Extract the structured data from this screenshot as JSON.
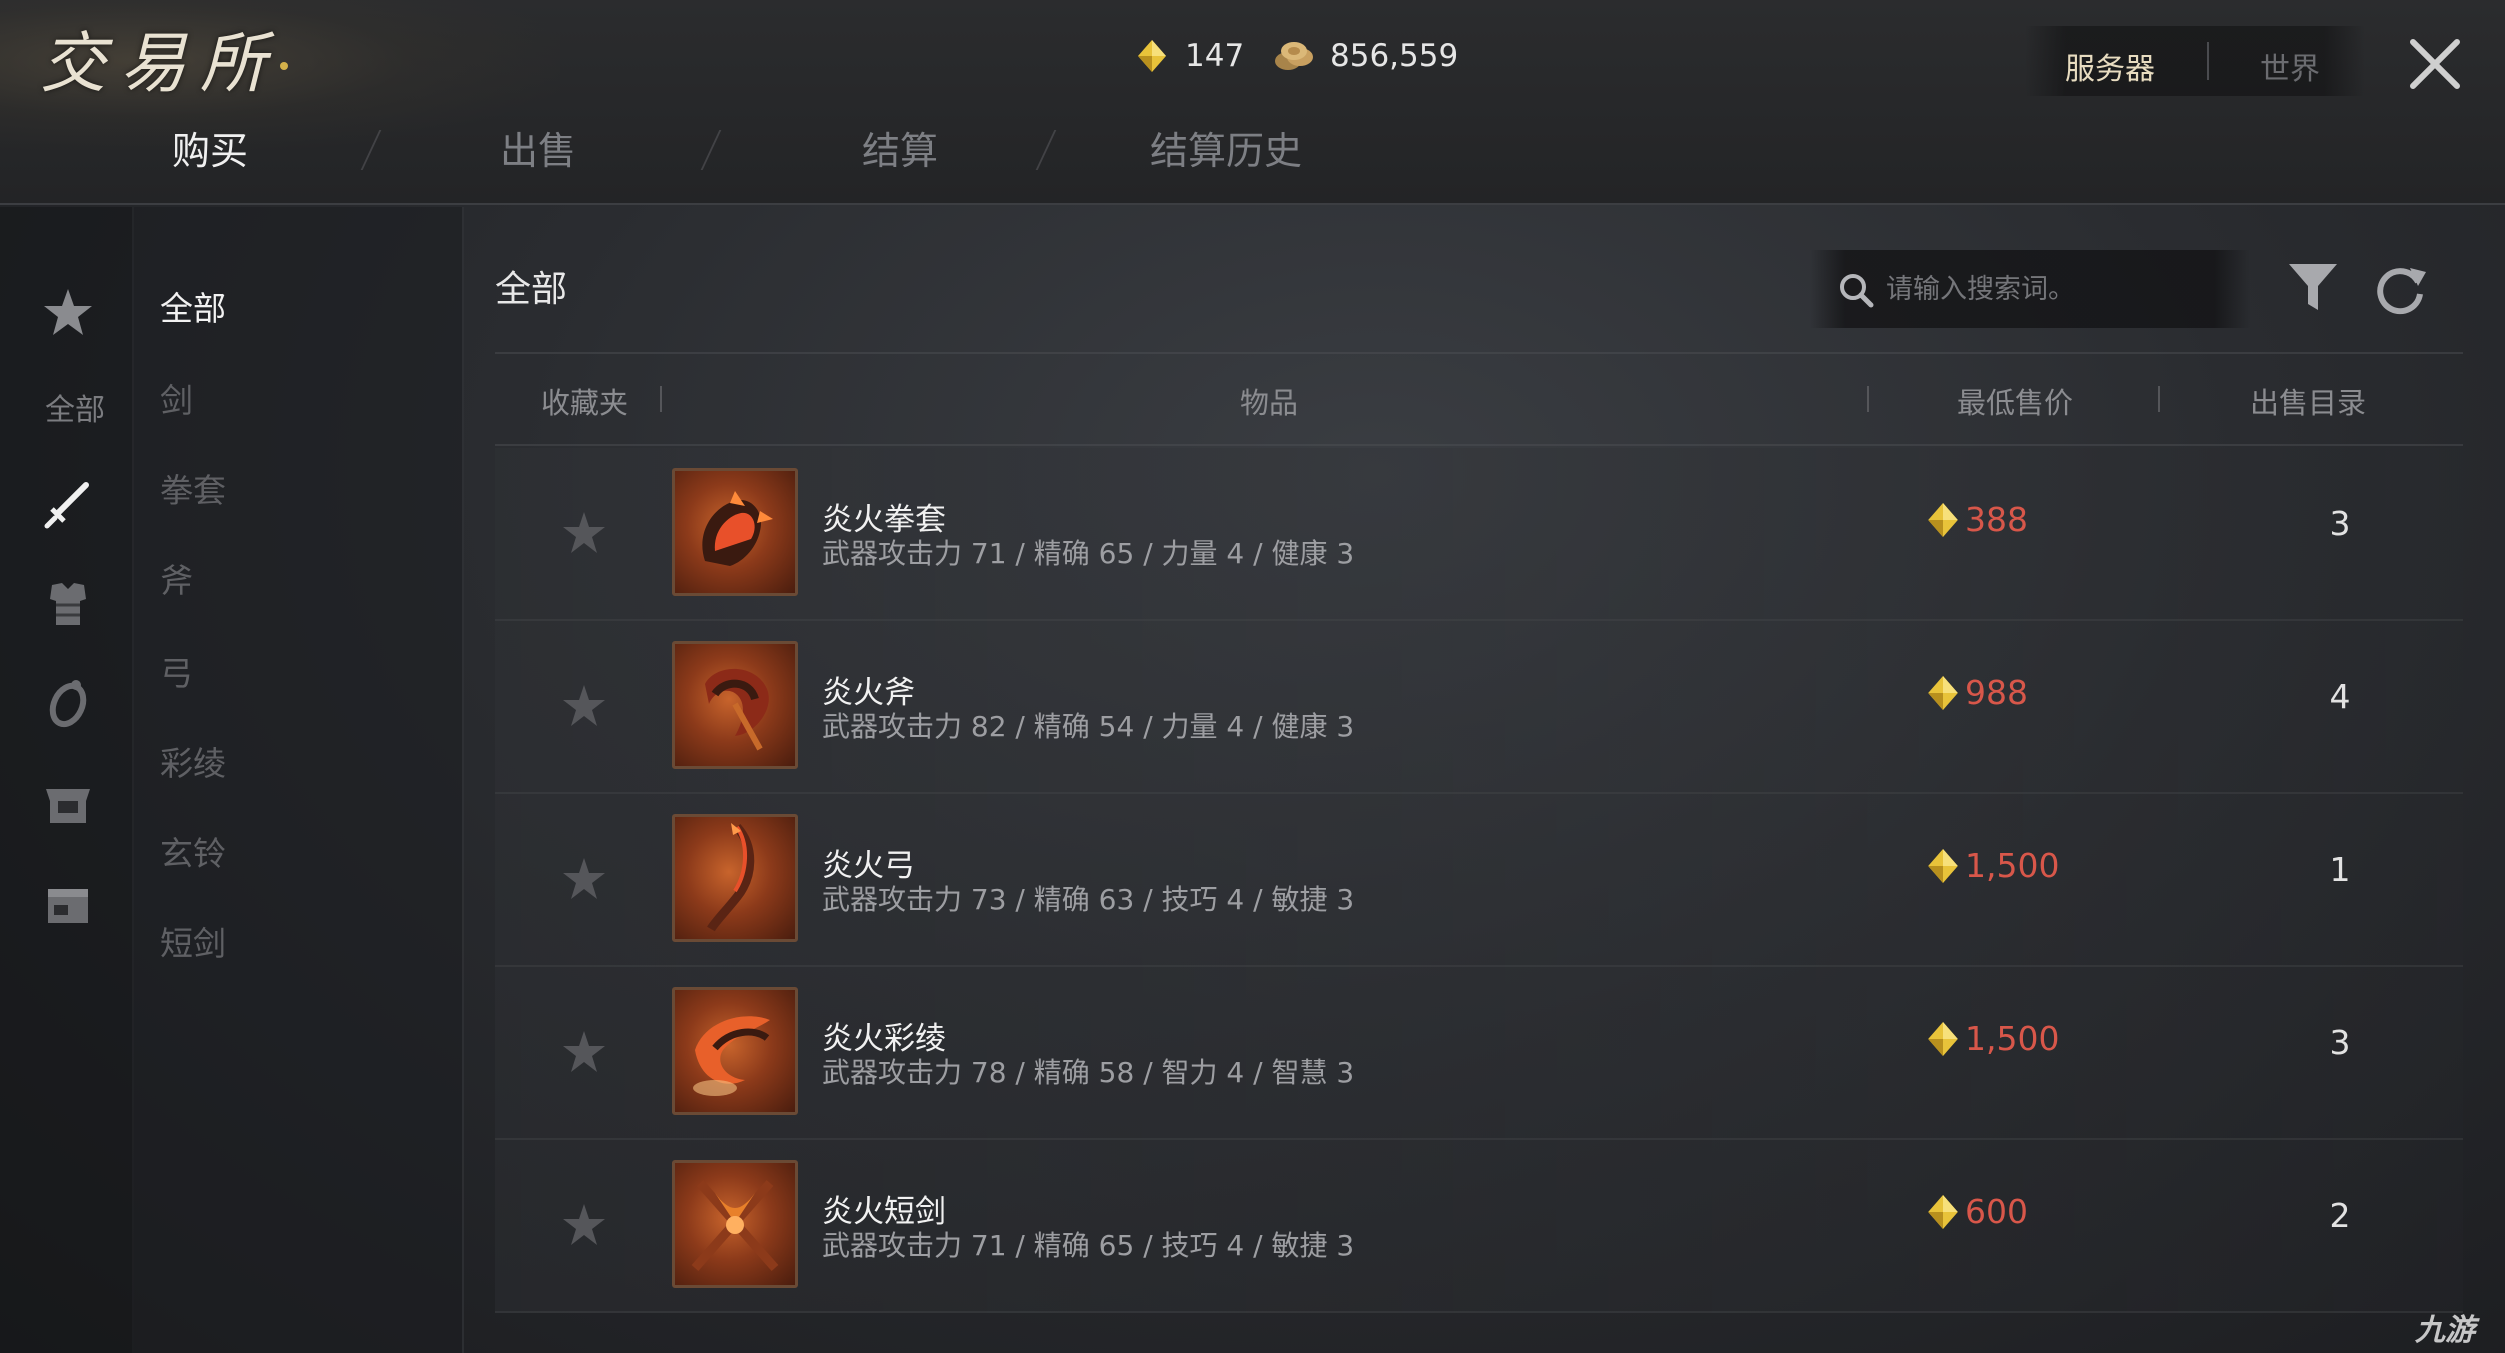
{
  "window": {
    "title": "交易所",
    "close_icon": "close-icon"
  },
  "currency": {
    "gems": "147",
    "coins": "856,559"
  },
  "server_switch": {
    "active": "服务器",
    "inactive": "世界"
  },
  "tabs": [
    {
      "label": "购买",
      "active": true
    },
    {
      "label": "出售",
      "active": false
    },
    {
      "label": "结算",
      "active": false
    },
    {
      "label": "结算历史",
      "active": false
    }
  ],
  "icon_column": {
    "label": "全部",
    "icons": [
      "star-icon",
      "sword-icon",
      "armor-icon",
      "ring-icon",
      "chest-icon",
      "box-icon"
    ]
  },
  "categories": [
    {
      "label": "全部",
      "active": true
    },
    {
      "label": "剑",
      "active": false
    },
    {
      "label": "拳套",
      "active": false
    },
    {
      "label": "斧",
      "active": false
    },
    {
      "label": "弓",
      "active": false
    },
    {
      "label": "彩绫",
      "active": false
    },
    {
      "label": "玄铃",
      "active": false
    },
    {
      "label": "短剑",
      "active": false
    }
  ],
  "main": {
    "section_title": "全部",
    "search": {
      "placeholder": "请输入搜索词。",
      "value": ""
    }
  },
  "table": {
    "headers": {
      "favorite": "收藏夹",
      "item": "物品",
      "lowest_price": "最低售价",
      "listings": "出售目录"
    },
    "rows": [
      {
        "name": "炎火拳套",
        "stats": "武器攻击力 71  / 精确 65  / 力量 4  / 健康 3",
        "price": "388",
        "count": "3"
      },
      {
        "name": "炎火斧",
        "stats": "武器攻击力 82  / 精确 54  / 力量 4  / 健康 3",
        "price": "988",
        "count": "4"
      },
      {
        "name": "炎火弓",
        "stats": "武器攻击力 73  / 精确 63  / 技巧 4  / 敏捷 3",
        "price": "1,500",
        "count": "1"
      },
      {
        "name": "炎火彩绫",
        "stats": "武器攻击力 78  / 精确 58  / 智力 4  / 智慧 3",
        "price": "1,500",
        "count": "3"
      },
      {
        "name": "炎火短剑",
        "stats": "武器攻击力 71  / 精确 65  / 技巧 4  / 敏捷 3",
        "price": "600",
        "count": "2"
      }
    ]
  },
  "colors": {
    "price": "#d8574a",
    "gem": "#e8c33a",
    "accent": "#e8dcc0"
  },
  "watermark": "九游"
}
